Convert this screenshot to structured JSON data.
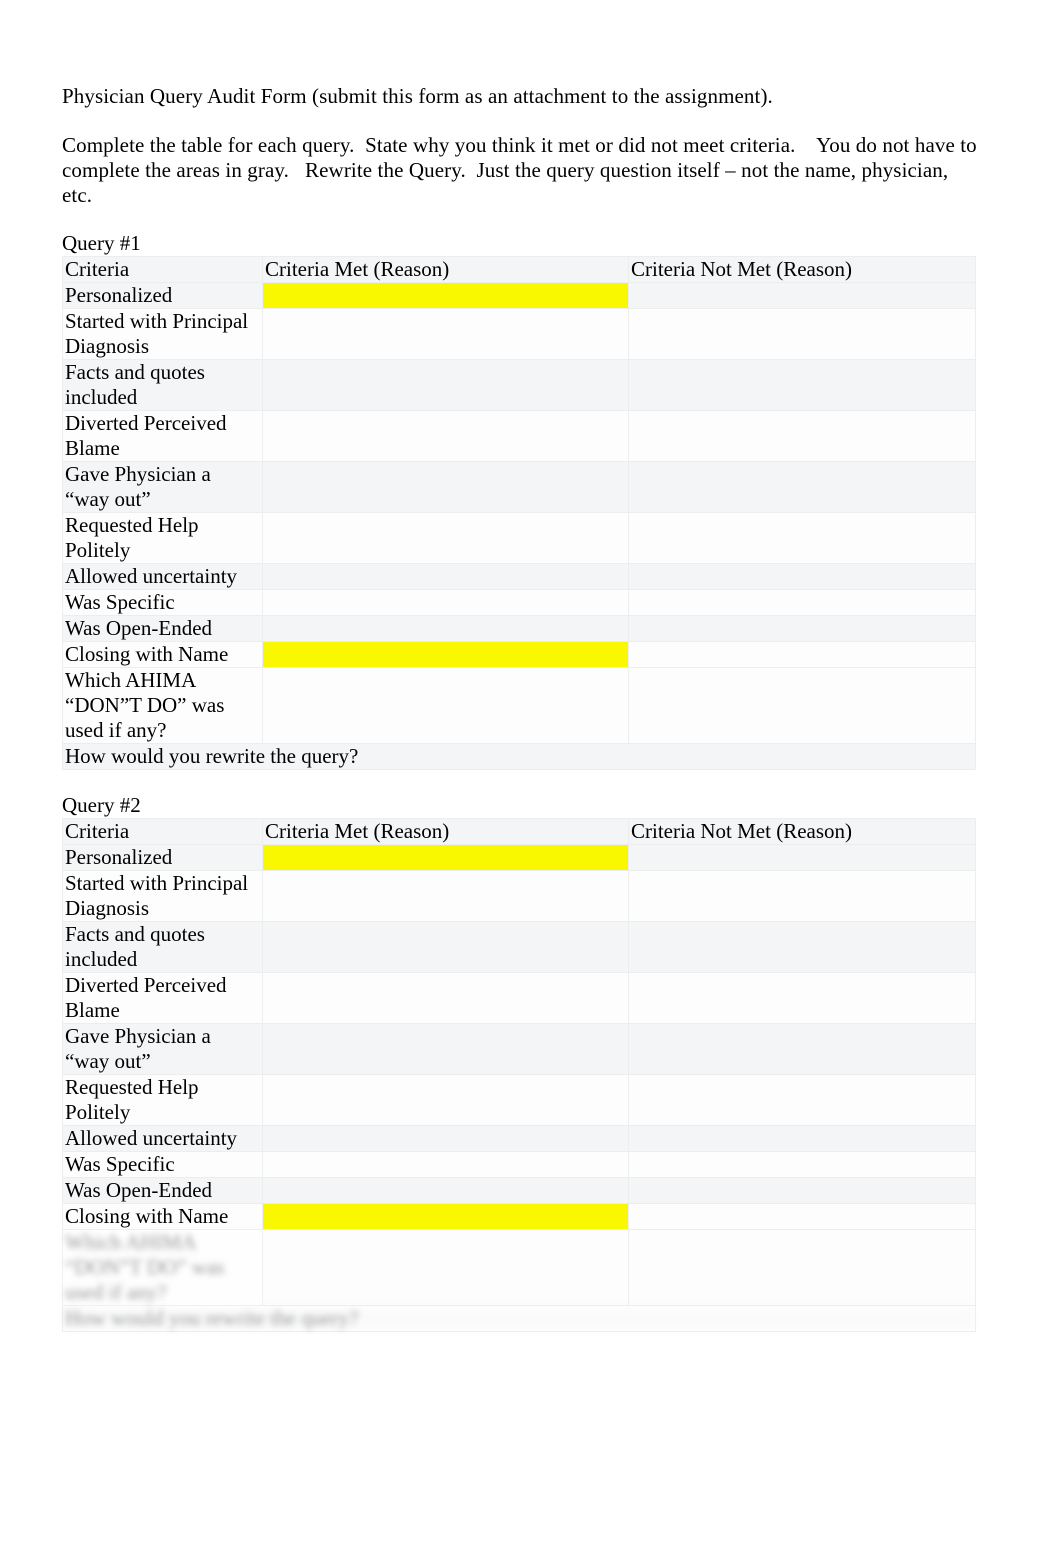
{
  "document": {
    "title_line": "Physician Query Audit Form (submit this form as an attachment to the assignment).",
    "instructions_line_1": "Complete the table for each query.  State why you think it met or did not meet criteria.    You do not have to",
    "instructions_line_2": "complete the areas in gray.   Rewrite the Query.  Just the query question itself – not the name, physician, etc."
  },
  "colors": {
    "highlight_yellow": "#faf800",
    "row_shade_gray": "#f4f5f6",
    "table_border": "#eceded",
    "text": "#000000"
  },
  "table_headers": {
    "criteria": "Criteria",
    "criteria_met": "Criteria Met (Reason)",
    "criteria_not_met": "Criteria Not Met (Reason)"
  },
  "criteria_rows": [
    {
      "label": "Personalized",
      "highlight_met": true,
      "lines": 1
    },
    {
      "label": "Started with Principal Diagnosis",
      "highlight_met": false,
      "lines": 2
    },
    {
      "label": "Facts and quotes included",
      "highlight_met": false,
      "lines": 2
    },
    {
      "label": "Diverted Perceived Blame",
      "highlight_met": false,
      "lines": 2
    },
    {
      "label": "Gave Physician a “way out”",
      "highlight_met": false,
      "lines": 2
    },
    {
      "label": "Requested Help Politely",
      "highlight_met": false,
      "lines": 2
    },
    {
      "label": "Allowed uncertainty",
      "highlight_met": false,
      "lines": 1
    },
    {
      "label": "Was Specific",
      "highlight_met": false,
      "lines": 1
    },
    {
      "label": "Was Open-Ended",
      "highlight_met": false,
      "lines": 1
    },
    {
      "label": "Closing with Name",
      "highlight_met": true,
      "lines": 1
    },
    {
      "label": "Which AHIMA “DON”T DO” was used if any?",
      "highlight_met": false,
      "lines": 3
    }
  ],
  "rewrite_row_label": "How would you rewrite the query?",
  "queries": [
    {
      "label": "Query #1",
      "blurred_tail": false
    },
    {
      "label": "Query #2",
      "blurred_tail": true
    }
  ]
}
